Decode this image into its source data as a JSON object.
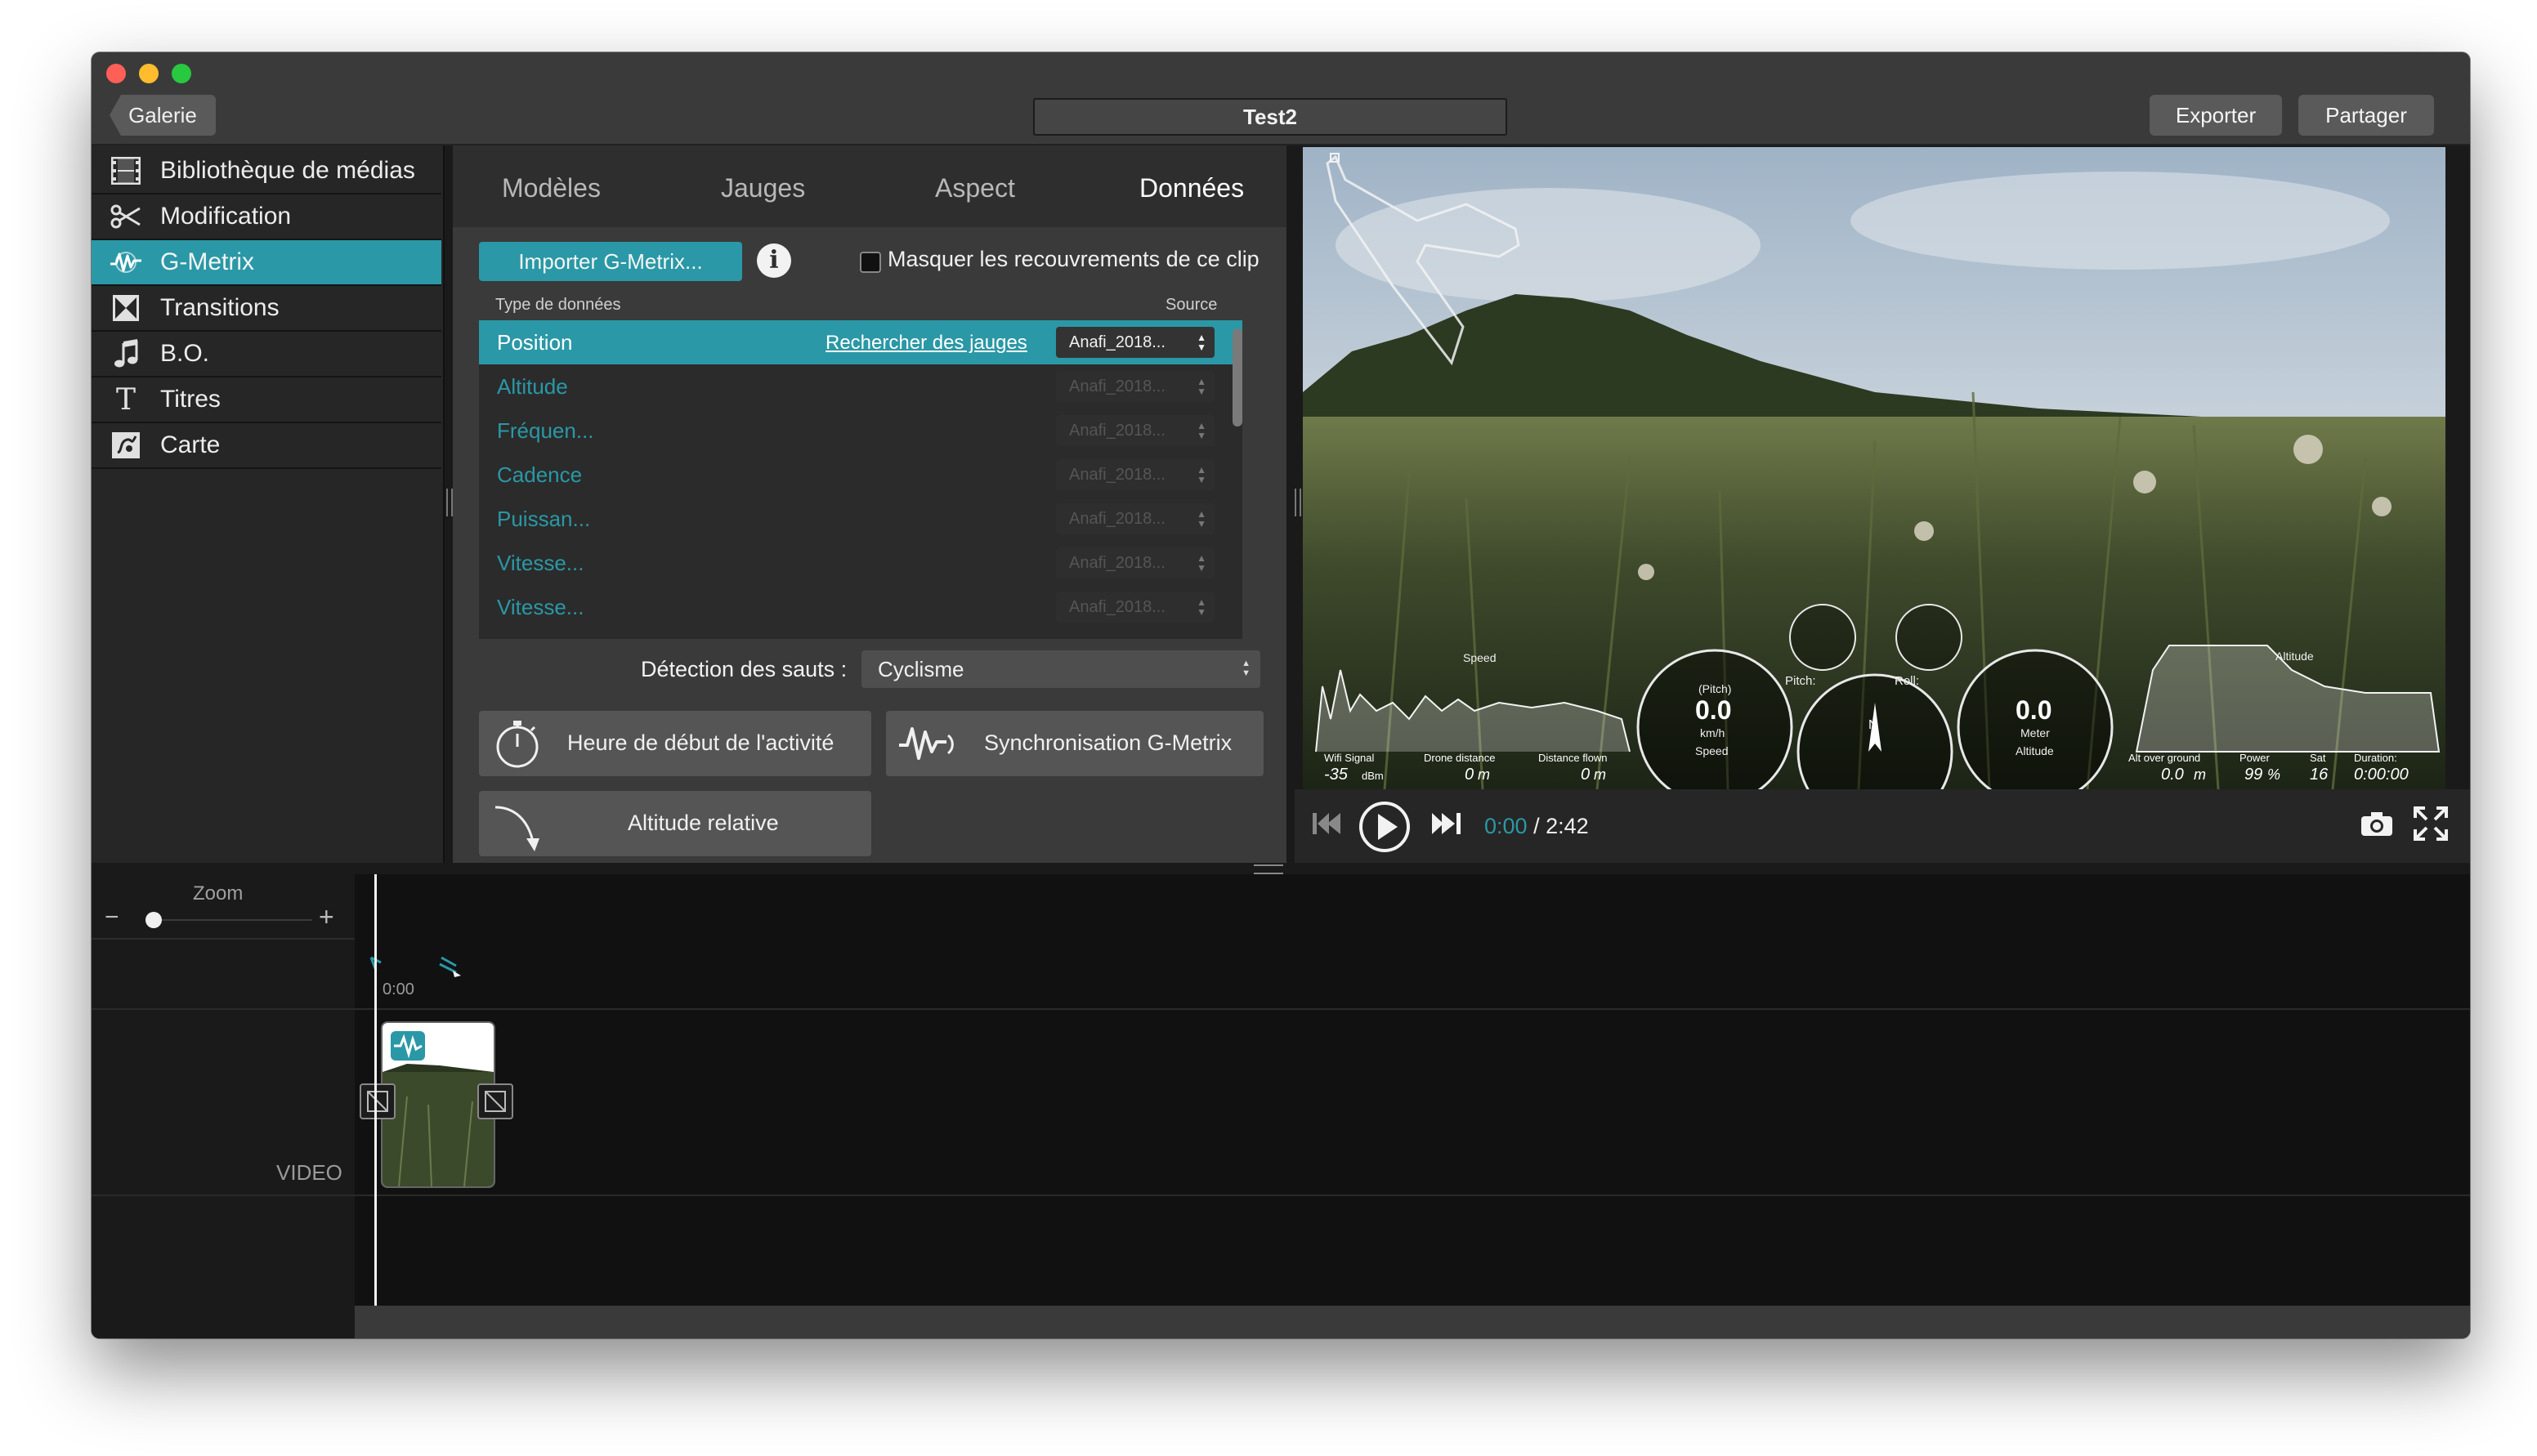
{
  "window": {
    "back_label": "Galerie",
    "title": "Test2",
    "export_label": "Exporter",
    "share_label": "Partager"
  },
  "sidebar": {
    "items": [
      {
        "label": "Bibliothèque de médias",
        "icon": "film-icon"
      },
      {
        "label": "Modification",
        "icon": "scissors-icon"
      },
      {
        "label": "G-Metrix",
        "icon": "gmetrix-icon",
        "active": true
      },
      {
        "label": "Transitions",
        "icon": "transitions-icon"
      },
      {
        "label": "B.O.",
        "icon": "music-note-icon"
      },
      {
        "label": "Titres",
        "icon": "title-t-icon"
      },
      {
        "label": "Carte",
        "icon": "map-icon"
      }
    ]
  },
  "tabs": [
    "Modèles",
    "Jauges",
    "Aspect",
    "Données"
  ],
  "active_tab": "Données",
  "data_panel": {
    "import_label": "Importer G-Metrix...",
    "hide_overlays_label": "Masquer les recouvrements de ce clip",
    "hide_overlays_checked": false,
    "col_type": "Type de données",
    "col_source": "Source",
    "rows": [
      {
        "label": "Position",
        "link": "Rechercher des jauges",
        "source": "Anafi_2018...",
        "active": true
      },
      {
        "label": "Altitude",
        "source": "Anafi_2018..."
      },
      {
        "label": "Fréquen...",
        "source": "Anafi_2018..."
      },
      {
        "label": "Cadence",
        "source": "Anafi_2018..."
      },
      {
        "label": "Puissan...",
        "source": "Anafi_2018..."
      },
      {
        "label": "Vitesse...",
        "source": "Anafi_2018..."
      },
      {
        "label": "Vitesse...",
        "source": "Anafi_2018..."
      }
    ],
    "jump_detection_label": "Détection des sauts :",
    "jump_detection_value": "Cyclisme",
    "start_time_label": "Heure de début de l'activité",
    "sync_label": "Synchronisation G-Metrix",
    "relative_altitude_label": "Altitude relative"
  },
  "overlay": {
    "speed_label": "Speed",
    "altitude_label": "Altitude",
    "pitch_label": "Pitch:",
    "roll_label": "Roll:",
    "gauge_speed": {
      "value": "0.0",
      "unit": "km/h",
      "name": "Speed",
      "top": "(Pitch)"
    },
    "gauge_alt": {
      "value": "0.0",
      "unit": "Meter",
      "name": "Altitude"
    },
    "compass_n": "N",
    "stats": [
      {
        "label": "Wifi Signal",
        "value": "-35",
        "unit": "dBm"
      },
      {
        "label": "Drone distance",
        "value": "0",
        "unit": "m"
      },
      {
        "label": "Distance flown",
        "value": "0",
        "unit": "m"
      },
      {
        "label": "Alt over ground",
        "value": "0.0",
        "unit": "m"
      },
      {
        "label": "Power",
        "value": "99",
        "unit": "%"
      },
      {
        "label": "Sat",
        "value": "16",
        "unit": ""
      },
      {
        "label": "Duration:",
        "value": "0:00:00",
        "unit": ""
      }
    ]
  },
  "player": {
    "current_time": "0:00",
    "separator": " / ",
    "duration": "2:42"
  },
  "timeline": {
    "zoom_label": "Zoom",
    "zoom_minus": "−",
    "zoom_plus": "+",
    "zoom_level": 0.08,
    "tick_label": "0:00",
    "track_label": "VIDEO"
  },
  "colors": {
    "accent": "#2a98a6",
    "window_bg": "#1a1a1a",
    "panel_bg": "#3a3a3a"
  }
}
